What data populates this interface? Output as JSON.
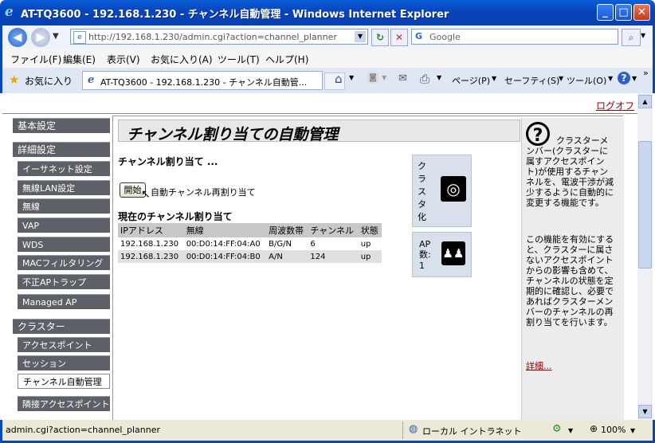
{
  "window": {
    "title": "AT-TQ3600 - 192.168.1.230 - チャンネル自動管理 - Windows Internet Explorer",
    "minimize": "_",
    "maximize": "□",
    "close": "✕"
  },
  "address_bar": {
    "url": "http://192.168.1.230/admin.cgi?action=channel_planner",
    "search_placeholder": "Google"
  },
  "menu": [
    "ファイル(F)",
    "編集(E)",
    "表示(V)",
    "お気に入り(A)",
    "ツール(T)",
    "ヘルプ(H)"
  ],
  "tab_bar": {
    "favorites": "お気に入り",
    "tab_title": "AT-TQ3600 - 192.168.1.230 - チャンネル自動管...",
    "page": "ページ(P)",
    "safety": "セーフティ(S)",
    "tools": "ツール(O)"
  },
  "logout": "ログオフ",
  "sidebar": {
    "basic": "基本設定",
    "advanced": "詳細設定",
    "ethernet": "イーサネット設定",
    "wireless_lan": "無線LAN設定",
    "wireless": "無線",
    "vap": "VAP",
    "wds": "WDS",
    "mac_filter": "MACフィルタリング",
    "rogue_ap": "不正APトラップ",
    "managed_ap": "Managed AP",
    "cluster": "クラスター",
    "access_points": "アクセスポイント",
    "sessions": "セッション",
    "channel_mgmt": "チャンネル自動管理",
    "neighbor_ap": "隣接アクセスポイント"
  },
  "main": {
    "heading": "チャンネル割り当ての自動管理",
    "section": "チャンネル割り当て ...",
    "start_button": "開始",
    "start_label": "自動チャンネル再割り当て",
    "current_title": "現在のチャンネル割り当て",
    "columns": [
      "IPアドレス",
      "無線",
      "周波数帯",
      "チャンネル",
      "状態"
    ],
    "rows": [
      [
        "192.168.1.230",
        "00:D0:14:FF:04:A0",
        "B/G/N",
        "6",
        "up"
      ],
      [
        "192.168.1.230",
        "00:D0:14:FF:04:B0",
        "A/N",
        "124",
        "up"
      ]
    ],
    "cluster_label": "クラスタ化",
    "ap_count_label": "AP数:",
    "ap_count": "1"
  },
  "help": {
    "icon": "?",
    "text1": "クラスターメンバー(クラスターに属すアクセスポイント)が使用するチャンネルを、電波干渉が減少するように自動的に変更する機能です。",
    "text2": "この機能を有効にすると、クラスターに属さないアクセスポイントからの影響も含めて、チャンネルの状態を定期的に確認し、必要であればクラスターメンバーのチャンネルの再割り当てを行います。",
    "more": "詳細..."
  },
  "status_bar": {
    "url": "admin.cgi?action=channel_planner",
    "zone": "ローカル イントラネット",
    "zoom": "100%"
  }
}
